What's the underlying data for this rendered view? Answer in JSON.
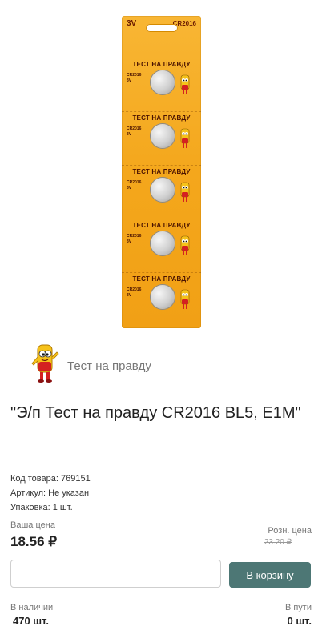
{
  "product_image": {
    "voltage": "3V",
    "model": "CR2016",
    "cell_title": "ТЕСТ НА ПРАВДУ",
    "cell_label_model": "CR2016",
    "cell_label_voltage": "3V",
    "cell_count": 5
  },
  "brand": {
    "name": "Тест на правду",
    "logo_icon": "brand-mascot-icon"
  },
  "product": {
    "title": "\"Э/п Тест на правду CR2016 BL5, E1M\"",
    "code": "Код товара: 769151",
    "article": "Артикул: Не указан",
    "package": "Упаковка: 1 шт."
  },
  "price": {
    "label": "Ваша цена",
    "value": "18.56 ₽",
    "retail_label": "Розн. цена",
    "retail_value": "23.20 ₽"
  },
  "cart": {
    "quantity_value": "",
    "button_label": "В корзину",
    "button_color": "#4d7775"
  },
  "stock": {
    "in_stock_label": "В наличии",
    "in_stock_value": "470 шт.",
    "in_transit_label": "В пути",
    "in_transit_value": "0 шт."
  }
}
